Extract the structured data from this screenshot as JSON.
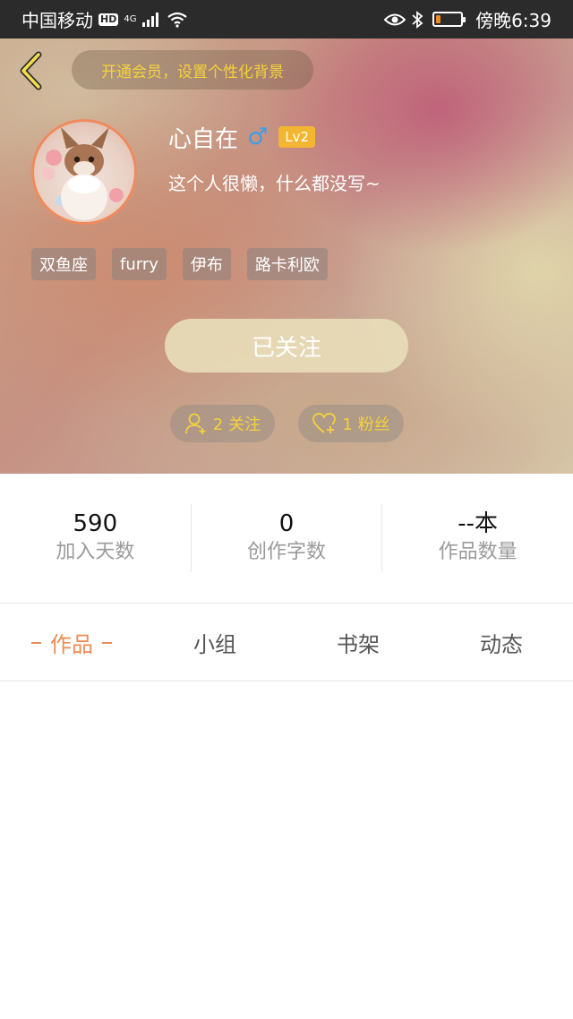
{
  "status_bar": {
    "carrier": "中国移动",
    "hd": "HD",
    "network": "4G",
    "time": "傍晚6:39",
    "battery_level": 0.2,
    "battery_color": "#f08a24"
  },
  "header": {
    "vip_prompt": "开通会员，设置个性化背景",
    "username": "心自在",
    "gender_symbol": "♂",
    "level": "Lv2",
    "bio": "这个人很懒，什么都没写~",
    "tags": [
      "双鱼座",
      "furry",
      "伊布",
      "路卡利欧"
    ],
    "follow_button": "已关注",
    "following": "2 关注",
    "fans": "1 粉丝"
  },
  "stats": [
    {
      "value": "590",
      "label": "加入天数"
    },
    {
      "value": "0",
      "label": "创作字数"
    },
    {
      "value": "--本",
      "label": "作品数量"
    }
  ],
  "tabs": {
    "active": "作品",
    "items": [
      "作品",
      "小组",
      "书架",
      "动态"
    ]
  },
  "colors": {
    "accent": "#ef8a52",
    "vip_text": "#f5d23c",
    "gender": "#3aa0e6",
    "level_badge": "#f3b632"
  },
  "icons": {
    "back": "chevron-left-icon",
    "gender": "male-icon",
    "following": "add-user-icon",
    "fans": "heart-plus-icon"
  }
}
